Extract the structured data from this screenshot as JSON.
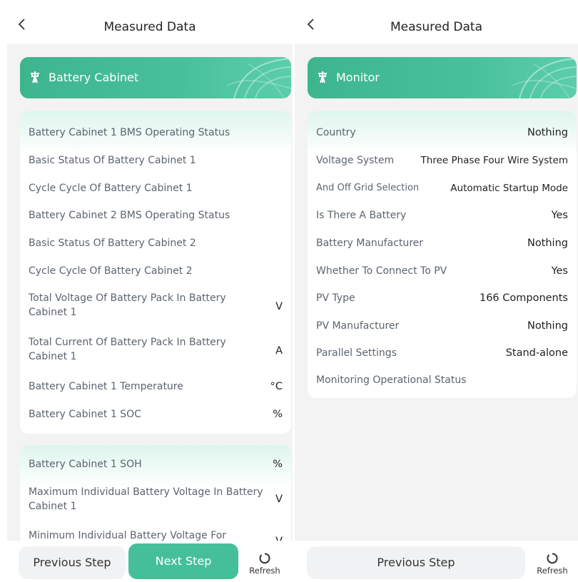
{
  "left_screen": {
    "title": "Measured Data",
    "section_title": "Battery Cabinet",
    "card1_rows": [
      {
        "label": "Battery Cabinet 1 BMS Operating Status",
        "unit": ""
      },
      {
        "label": "Basic Status Of Battery Cabinet 1",
        "unit": ""
      },
      {
        "label": "Cycle Cycle Of Battery Cabinet 1",
        "unit": ""
      },
      {
        "label": "Battery Cabinet 2 BMS Operating Status",
        "unit": ""
      },
      {
        "label": "Basic Status Of Battery Cabinet 2",
        "unit": ""
      },
      {
        "label": "Cycle Cycle Of Battery Cabinet 2",
        "unit": ""
      },
      {
        "label": "Total Voltage Of Battery Pack In Battery Cabinet 1",
        "unit": "V"
      },
      {
        "label": "Total Current Of Battery Pack In Battery Cabinet 1",
        "unit": "A"
      },
      {
        "label": "Battery Cabinet 1 Temperature",
        "unit": "°C"
      },
      {
        "label": "Battery Cabinet 1 SOC",
        "unit": "%"
      }
    ],
    "card2_rows": [
      {
        "label": "Battery Cabinet 1 SOH",
        "unit": "%"
      },
      {
        "label": "Maximum Individual Battery Voltage In Battery Cabinet 1",
        "unit": "V"
      },
      {
        "label": "Minimum Individual Battery Voltage For",
        "unit": "V"
      }
    ],
    "previous_label": "Previous Step",
    "next_label": "Next Step",
    "refresh_label": "Refresh"
  },
  "right_screen": {
    "title": "Measured Data",
    "section_title": "Monitor",
    "rows": [
      {
        "label": "Country",
        "value": "Nothing"
      },
      {
        "label": "Voltage System",
        "value": "Three Phase Four Wire System"
      },
      {
        "label": "And Off Grid Selection",
        "value": "Automatic Startup Mode"
      },
      {
        "label": "Is There A Battery",
        "value": "Yes"
      },
      {
        "label": "Battery Manufacturer",
        "value": "Nothing"
      },
      {
        "label": "Whether To Connect To PV",
        "value": "Yes"
      },
      {
        "label": "PV Type",
        "value": "166 Components"
      },
      {
        "label": "PV Manufacturer",
        "value": "Nothing"
      },
      {
        "label": "Parallel Settings",
        "value": "Stand-alone"
      },
      {
        "label": "Monitoring Operational Status",
        "value": ""
      }
    ],
    "previous_label": "Previous Step",
    "refresh_label": "Refresh"
  },
  "icons": {
    "back": "back-chevron-icon",
    "section": "transmission-tower-icon",
    "refresh": "refresh-icon"
  },
  "colors": {
    "accent": "#45bf98",
    "card_header_start": "#3db58e",
    "card_header_end": "#5ccdaa",
    "card_tint": "#ddf5ec",
    "background": "#f3f3f3"
  }
}
